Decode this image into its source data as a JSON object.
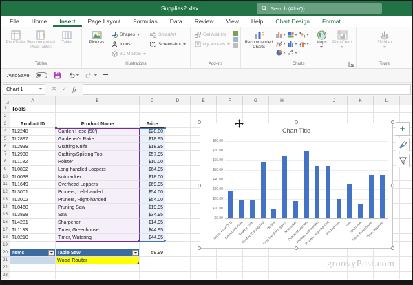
{
  "titlebar": {
    "title": "Supplies2.xlsx",
    "search_placeholder": "Search (Alt+Q)"
  },
  "tabs": [
    {
      "label": "File"
    },
    {
      "label": "Home"
    },
    {
      "label": "Insert",
      "selected": true
    },
    {
      "label": "Page Layout"
    },
    {
      "label": "Formulas"
    },
    {
      "label": "Data"
    },
    {
      "label": "Review"
    },
    {
      "label": "View"
    },
    {
      "label": "Help"
    },
    {
      "label": "Chart Design",
      "contextual": true
    },
    {
      "label": "Format",
      "contextual": true
    }
  ],
  "ribbon": {
    "tables": {
      "label": "Tables",
      "pivottable": "PivotTable",
      "recommended_pivottables": "Recommended PivotTables",
      "table": "Table"
    },
    "illustrations": {
      "label": "Illustrations",
      "pictures": "Pictures",
      "shapes": "Shapes",
      "icons": "Icons",
      "models": "3D Models",
      "smartart": "SmartArt",
      "screenshot": "Screenshot"
    },
    "addins": {
      "label": "Add-ins",
      "get_addins": "Get Add-ins",
      "my_addins": "My Add-ins"
    },
    "charts": {
      "label": "Charts",
      "recommended": "Recommended Charts",
      "maps": "Maps",
      "pivotchart": "PivotChart"
    },
    "tours": {
      "label": "Tours",
      "map3d": "3D Map"
    }
  },
  "quick_access": {
    "autosave_label": "AutoSave"
  },
  "formula_bar": {
    "name_box": "Chart 1",
    "fx_label": "fx",
    "formula_value": ""
  },
  "sheet": {
    "columns": [
      "A",
      "B",
      "C",
      "D",
      "E",
      "F",
      "G",
      "H",
      "I",
      "J",
      "K",
      "L"
    ],
    "row_count": 23,
    "title_cell": "Tools",
    "headers": [
      "Product ID",
      "Product Name",
      "Price"
    ],
    "products": [
      {
        "id": "TL2248",
        "name": "Garden Hose (50')",
        "price": "$28.00"
      },
      {
        "id": "TL2897",
        "name": "Gardener's Rake",
        "price": "$18.95"
      },
      {
        "id": "TL2939",
        "name": "Grafting Knife",
        "price": "$18.95"
      },
      {
        "id": "TL2938",
        "name": "Grafting/Splicing Tool",
        "price": "$57.95"
      },
      {
        "id": "TL1182",
        "name": "Holster",
        "price": "$10.00"
      },
      {
        "id": "TL0802",
        "name": "Long handled Loppers",
        "price": "$64.95"
      },
      {
        "id": "TL0038",
        "name": "Nutcracker",
        "price": "$18.00"
      },
      {
        "id": "TL1649",
        "name": "Overhead Loppers",
        "price": "$69.95"
      },
      {
        "id": "TL3001",
        "name": "Pruners, Left-handed",
        "price": "$54.00"
      },
      {
        "id": "TL3002",
        "name": "Pruners, Right-handed",
        "price": "$54.00"
      },
      {
        "id": "TL0460",
        "name": "Pruning Saw",
        "price": "$19.95"
      },
      {
        "id": "TL3898",
        "name": "Saw",
        "price": "$34.95"
      },
      {
        "id": "TL4281",
        "name": "Sharpener",
        "price": "$14.95"
      },
      {
        "id": "TL1133",
        "name": "Timer, Greenhouse",
        "price": "$44.95"
      },
      {
        "id": "TL0210",
        "name": "Timer, Watering",
        "price": "$44.95"
      }
    ],
    "row20": {
      "label": "Items",
      "value": "Table Saw",
      "price": "59.99"
    },
    "row21": {
      "value": "Wood Router"
    }
  },
  "chart_data": {
    "type": "bar",
    "title": "Chart Title",
    "categories": [
      "Garden Hose (50')",
      "Gardener's Rake",
      "Grafting Knife",
      "Grafting/Splicing Tool",
      "Holster",
      "Long handled Loppers",
      "Nutcracker",
      "Overhead Loppers",
      "Pruners, Left-handed",
      "Pruners, Right-handed",
      "Pruning Saw",
      "Saw",
      "Sharpener",
      "Timer, Greenhouse",
      "Timer, Watering"
    ],
    "values": [
      28,
      18.95,
      18.95,
      57.95,
      10,
      64.95,
      18,
      69.95,
      54,
      54,
      19.95,
      34.95,
      14.95,
      44.95,
      44.95
    ],
    "ylabels": [
      "$80.00",
      "$70.00",
      "$60.00",
      "$50.00",
      "$40.00",
      "$30.00",
      "$20.00",
      "$10.00",
      "$0.00"
    ],
    "ylim": [
      0,
      80
    ],
    "grid": true,
    "legend": "none",
    "bar_color": "#4472C4"
  },
  "watermark": "groovyPost.com",
  "colors": {
    "excel_green": "#217346",
    "bar_color": "#4472C4",
    "range_purple": "#7030A0",
    "range_blue": "#4472C4",
    "dropdown_blue": "#3D6BA1",
    "highlight_yellow": "#FFFF00",
    "lightblue_fill": "#C9D9EC"
  }
}
